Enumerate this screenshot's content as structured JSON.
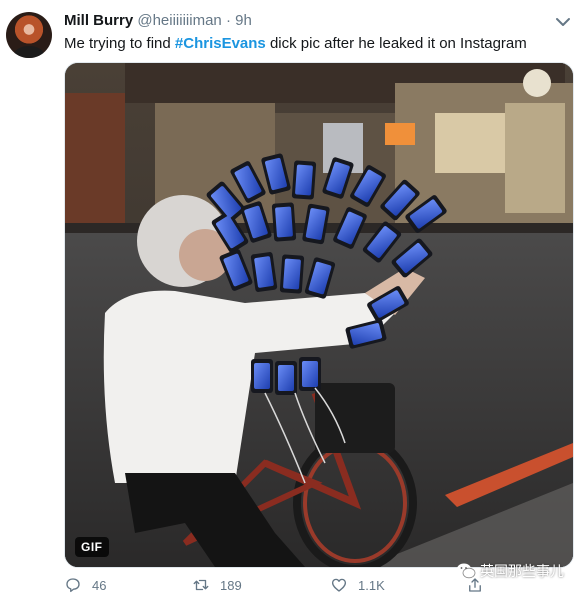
{
  "tweet": {
    "author_name": "Mill Burry",
    "handle": "@heiiiiiiiman",
    "separator": "·",
    "time": "9h",
    "text_before": "Me trying to find ",
    "hashtag": "#ChrisEvans",
    "text_after": " dick pic after he leaked it on Instagram"
  },
  "media": {
    "badge": "GIF",
    "description": "older man on a bicycle with many smartphones mounted on handlebars"
  },
  "actions": {
    "replies": "46",
    "retweets": "189",
    "likes": "1.1K"
  },
  "watermark": {
    "text": "英国那些事儿"
  },
  "icons": [
    "chevron-down-icon",
    "reply-icon",
    "retweet-icon",
    "like-icon",
    "share-icon",
    "wechat-logo-icon"
  ],
  "colors": {
    "link": "#1b95e0",
    "muted": "#657786",
    "text": "#14171a",
    "phone_screen": "#3b6fe0"
  }
}
